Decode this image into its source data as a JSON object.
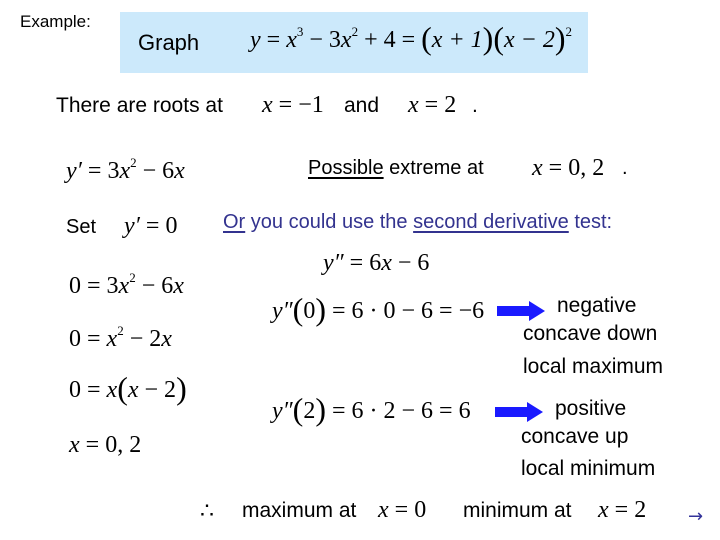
{
  "example_label": "Example:",
  "graph_box": {
    "label": "Graph",
    "equation": {
      "lhs": "y",
      "eq1": " = ",
      "x": "x",
      "exp3": "3",
      "minus3": " − 3",
      "x2": "x",
      "exp2": "2",
      "plus4": " + 4 = ",
      "factor1_open": "(",
      "factor1": "x + 1",
      "factor1_close": ")",
      "factor2_open": "(",
      "factor2": "x − 2",
      "factor2_close": ")",
      "factor2_exp": "2"
    },
    "background_color": "#cce9fb"
  },
  "roots": {
    "prefix": "There are roots at",
    "root1_var": "x",
    "root1_rest": " = −1",
    "connector": "and",
    "root2_var": "x",
    "root2_rest": " = 2",
    "suffix": "."
  },
  "first_derivative": {
    "lhs": "y′",
    "eq": " = 3",
    "x": "x",
    "exp": "2",
    "rest": " − 6",
    "x2": "x"
  },
  "possible_extreme": {
    "underlined": "Possible",
    "text": " extreme at",
    "var": "x",
    "values": " = 0,  2",
    "suffix": "."
  },
  "set_line": {
    "label": "Set",
    "lhs": "y′",
    "rhs": " = 0"
  },
  "second_derivative_intro": {
    "underlined_or": "Or",
    "text1": " you could use the ",
    "underlined_test": "second derivative",
    "text2": " test:",
    "color": "#33338f"
  },
  "second_derivative": {
    "lhs": "y″",
    "eq": " = 6",
    "x": "x",
    "rest": " − 6"
  },
  "solve_steps": [
    {
      "id": "step1",
      "a": "0 = 3",
      "x": "x",
      "exp": "2",
      "b": " − 6",
      "x2": "x"
    },
    {
      "id": "step2",
      "a": "0 = ",
      "x": "x",
      "exp": "2",
      "b": " − 2",
      "x2": "x"
    },
    {
      "id": "step3",
      "a": "0 = ",
      "x": "x",
      "open": "(",
      "inner_x": "x",
      "inner": " − 2",
      "close": ")"
    },
    {
      "id": "step4",
      "x": "x",
      "rest": " = 0,  2"
    }
  ],
  "test_at_zero": {
    "lhs": "y″",
    "open": "(",
    "arg": "0",
    "close": ")",
    "rhs": " = 6 · 0 − 6 = −6",
    "result_lines": [
      "negative",
      "concave down",
      "local maximum"
    ]
  },
  "test_at_two": {
    "lhs": "y″",
    "open": "(",
    "arg": "2",
    "close": ")",
    "rhs": " = 6 · 2 − 6 = 6",
    "result_lines": [
      "positive",
      "concave up",
      "local minimum"
    ]
  },
  "arrow_color": "#1a1aff",
  "conclusion": {
    "therefore": "∴",
    "max_text": "maximum at",
    "max_var": "x",
    "max_val": " = 0",
    "min_text": "minimum at",
    "min_var": "x",
    "min_val": " = 2"
  },
  "next_slide_arrow": "→"
}
